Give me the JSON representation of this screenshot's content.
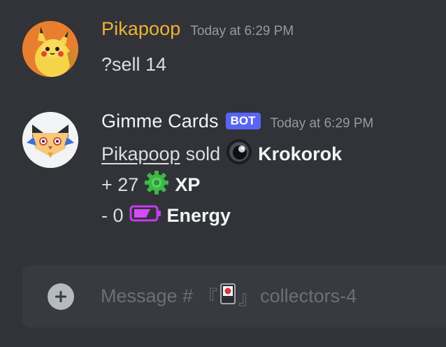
{
  "messages": [
    {
      "author": "Pikapoop",
      "timestamp": "Today at 6:29 PM",
      "text": "?sell 14",
      "author_color": "#f0b232",
      "avatar_icon": "pikachu-avatar"
    },
    {
      "author": "Gimme Cards",
      "bot_tag": "BOT",
      "timestamp": "Today at 6:29 PM",
      "author_color": "#f2f3f5",
      "avatar_icon": "cat-bot-avatar",
      "sold_line": {
        "mention": "Pikapoop",
        "verb": "sold",
        "card_icon": "dark-orb-icon",
        "card_name": "Krokorok"
      },
      "xp_line": {
        "amount": "+ 27",
        "icon": "green-gear-icon",
        "label": "XP"
      },
      "energy_line": {
        "amount": "- 0",
        "icon": "battery-icon",
        "label": "Energy"
      }
    }
  ],
  "composer": {
    "prefix": "Message #",
    "channel_open": "『",
    "channel_icon": "hanafuda-card-icon",
    "channel_close": "』",
    "channel_name": "collectors-4",
    "add_icon": "plus-circle-icon"
  },
  "colors": {
    "background": "#313338",
    "composer": "#383a40",
    "bot_tag": "#5865f2",
    "timestamp": "#949ba4",
    "text": "#dbdee1"
  }
}
